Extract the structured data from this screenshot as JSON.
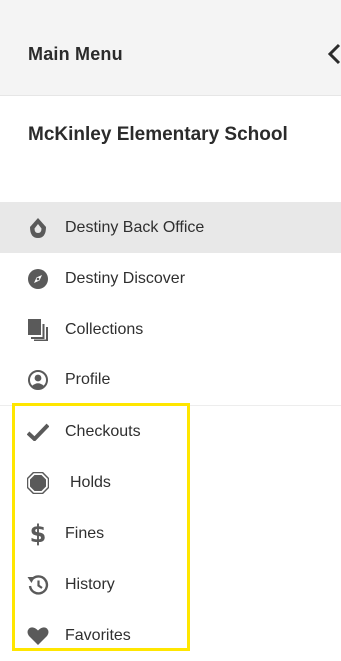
{
  "header": {
    "title": "Main Menu",
    "collapse_icon": "chevron-left-icon"
  },
  "school": {
    "name": "McKinley Elementary School"
  },
  "nav": {
    "items": [
      {
        "label": "Destiny Back Office",
        "icon": "back-office-icon",
        "active": true
      },
      {
        "label": "Destiny Discover",
        "icon": "compass-icon"
      },
      {
        "label": "Collections",
        "icon": "collections-icon"
      },
      {
        "label": "Profile",
        "icon": "profile-icon"
      },
      {
        "label": "Checkouts",
        "icon": "checkmark-icon"
      },
      {
        "label": "Holds",
        "icon": "holds-icon"
      },
      {
        "label": "Fines",
        "icon": "dollar-icon"
      },
      {
        "label": "History",
        "icon": "history-icon"
      },
      {
        "label": "Favorites",
        "icon": "heart-icon"
      }
    ]
  },
  "colors": {
    "icon": "#5a5a5a",
    "active_bg": "#e8e8e8",
    "header_bg": "#f4f4f4",
    "highlight": "#ffe600"
  }
}
